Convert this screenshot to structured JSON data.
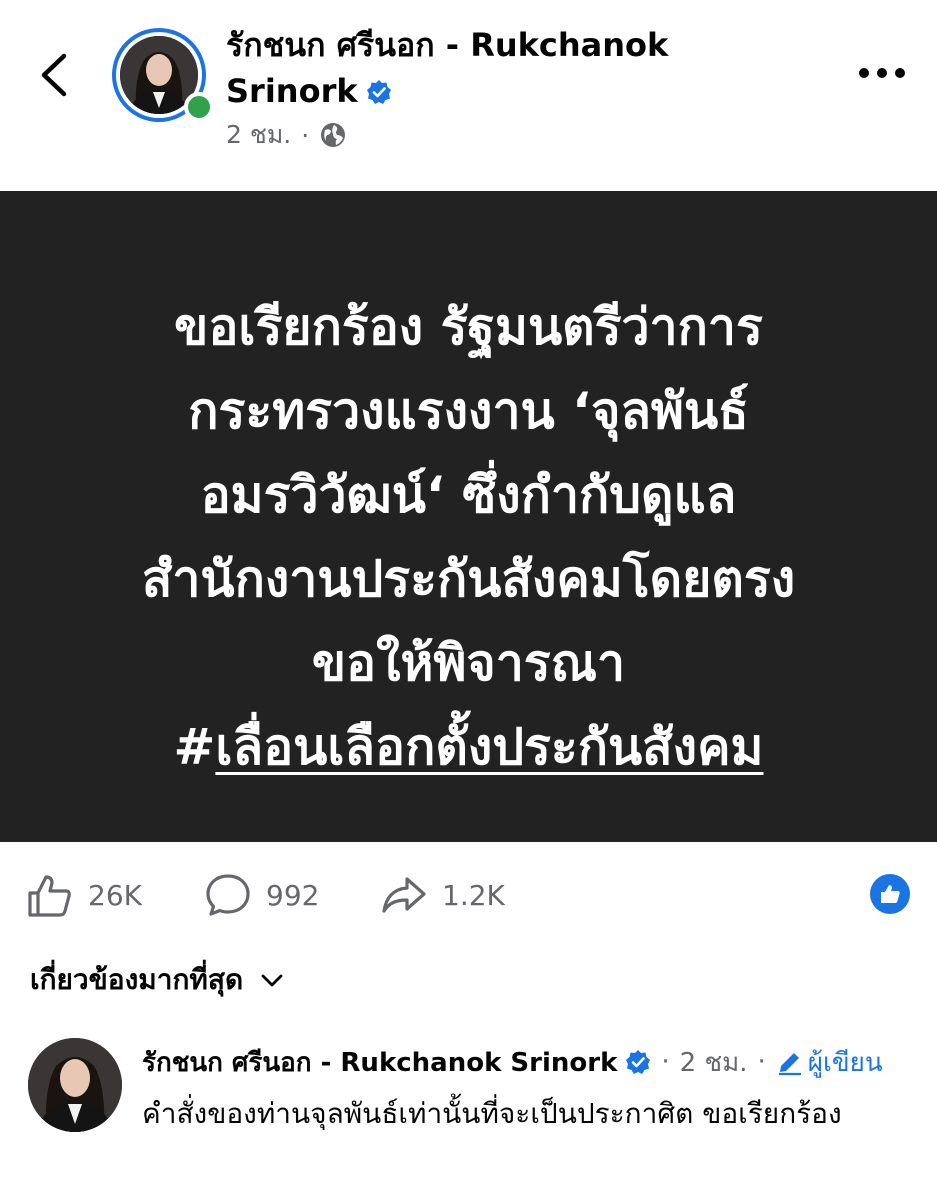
{
  "header": {
    "back_icon": "chevron-left-icon",
    "author_name": "รักชนก ศรีนอก - Rukchanok Srinork",
    "verified_icon": "verified-badge-icon",
    "time": "2 ชม.",
    "separator": "·",
    "audience_icon": "globe-icon",
    "more_icon": "more-horizontal-icon",
    "online_status_color": "#31a24c"
  },
  "post": {
    "image_background": "#222222",
    "lines": [
      "ขอเรียกร้อง รัฐมนตรีว่าการ",
      "กระทรวงแรงงาน ‘จุลพันธ์",
      "อมรวิวัฒน์‘ ซึ่งกำกับดูแล",
      "สำนักงานประกันสังคมโดยตรง",
      "ขอให้พิจารณา"
    ],
    "hashtag_symbol": "#",
    "hashtag_text": "เลื่อนเลือกตั้งประกันสังคม"
  },
  "actions": {
    "likes": "26K",
    "comments": "992",
    "shares": "1.2K",
    "like_icon": "thumbs-up-icon",
    "comment_icon": "speech-bubble-icon",
    "share_icon": "share-arrow-icon",
    "reaction_badge_icon": "like-reaction-icon",
    "accent_color": "#1b74e4"
  },
  "comments_sort": {
    "label": "เกี่ยวข้องมากที่สุด",
    "icon": "chevron-down-icon"
  },
  "comment": {
    "author": "รักชนก ศรีนอก - Rukchanok Srinork",
    "separator": "·",
    "time": "2 ชม.",
    "author_badge_label": "ผู้เขียน",
    "author_badge_icon": "pencil-icon",
    "text": "คำสั่งของท่านจุลพันธ์เท่านั้นที่จะเป็นประกาศิต ขอเรียกร้อง"
  }
}
